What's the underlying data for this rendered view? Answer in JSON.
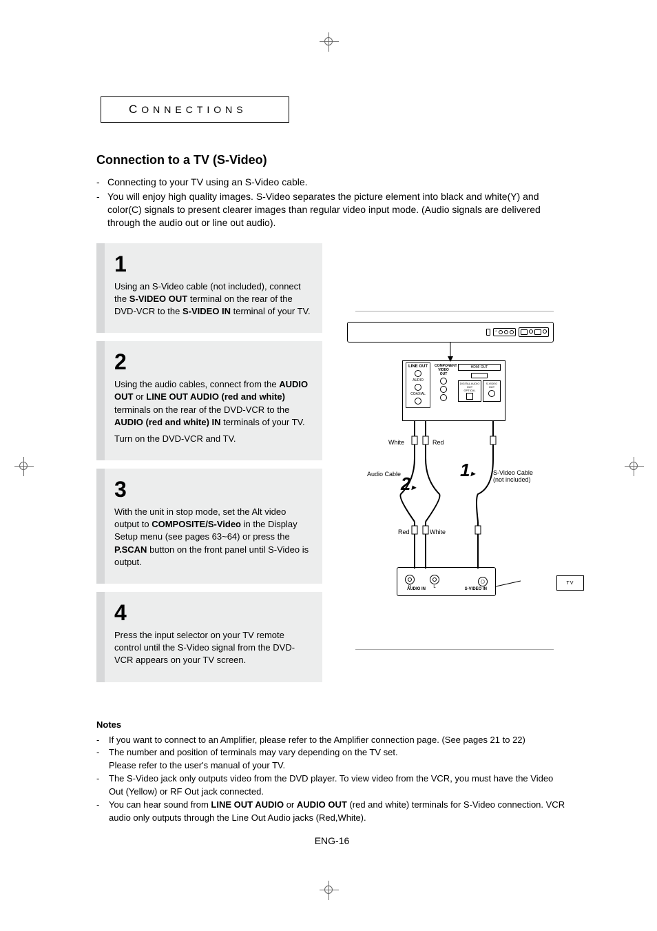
{
  "section_tab": "CONNECTIONS",
  "heading": "Connection to a TV (S-Video)",
  "intro": [
    "Connecting to your TV using an S-Video cable.",
    "You will enjoy high quality images. S-Video separates the picture element into black and white(Y) and color(C) signals to present clearer images than regular video input mode. (Audio signals are delivered through the audio out or line out audio)."
  ],
  "steps": [
    {
      "num": "1",
      "body_parts": [
        {
          "t": "Using an S-Video cable (not included), connect the "
        },
        {
          "t": "S-VIDEO OUT",
          "b": true
        },
        {
          "t": " terminal on the rear of the DVD-VCR to the "
        },
        {
          "t": "S-VIDEO IN",
          "b": true
        },
        {
          "t": " terminal of your TV."
        }
      ]
    },
    {
      "num": "2",
      "body_parts": [
        {
          "t": "Using the audio cables, connect from the "
        },
        {
          "t": "AUDIO OUT",
          "b": true
        },
        {
          "t": " or "
        },
        {
          "t": "LINE OUT AUDIO (red and white)",
          "b": true
        },
        {
          "t": " terminals on the rear of the DVD-VCR to the "
        },
        {
          "t": "AUDIO (red and white) IN",
          "b": true
        },
        {
          "t": " terminals of your TV."
        }
      ],
      "extra": "Turn on the DVD-VCR and TV."
    },
    {
      "num": "3",
      "body_parts": [
        {
          "t": "With the unit in stop mode, set the Alt video output to "
        },
        {
          "t": "COMPOSITE/S-Video",
          "b": true
        },
        {
          "t": " in the Display Setup menu (see pages 63~64) or press the "
        },
        {
          "t": "P.SCAN",
          "b": true
        },
        {
          "t": " button on the front panel until S-Video is output."
        }
      ]
    },
    {
      "num": "4",
      "body_parts": [
        {
          "t": "Press the input selector on your TV remote control until the S-Video signal from the DVD-VCR appears on your TV screen."
        }
      ]
    }
  ],
  "diagram": {
    "white_label": "White",
    "red_label": "Red",
    "audio_cable": "Audio Cable",
    "svideo_cable_line1": "S-Video Cable",
    "svideo_cable_line2": "(not included)",
    "num1": "1",
    "num2": "2",
    "tv_label": "TV",
    "audio_in": "AUDIO IN",
    "svideo_in": "S-VIDEO IN",
    "back_lineout": "LINE OUT",
    "back_audio": "AUDIO",
    "back_component": "COMPONENT VIDEO OUT",
    "back_hdmi": "HDMI OUT",
    "back_digital": "DIGITAL AUDIO OUT",
    "back_optical": "OPTICAL",
    "back_svideo": "S-VIDEO OUT",
    "back_coaxial": "COAXIAL"
  },
  "notes_title": "Notes",
  "notes": [
    {
      "lines": [
        "If you want to connect to an Amplifier, please refer to the Amplifier connection page. (See pages 21 to 22)"
      ]
    },
    {
      "lines": [
        "The number and position of terminals may vary depending on the TV set.",
        "Please refer to the user's manual of your TV."
      ]
    },
    {
      "lines": [
        "The S-Video jack only outputs video from the DVD player. To view video from the VCR, you must have the Video Out (Yellow) or RF Out jack connected."
      ]
    },
    {
      "plain": "You can hear sound from ",
      "bold1": "LINE OUT AUDIO",
      "mid": " or ",
      "bold2": "AUDIO OUT",
      "tail": " (red and white) terminals for S-Video connection. VCR audio only outputs through the Line Out Audio jacks (Red,White)."
    }
  ],
  "footer": "ENG-16"
}
